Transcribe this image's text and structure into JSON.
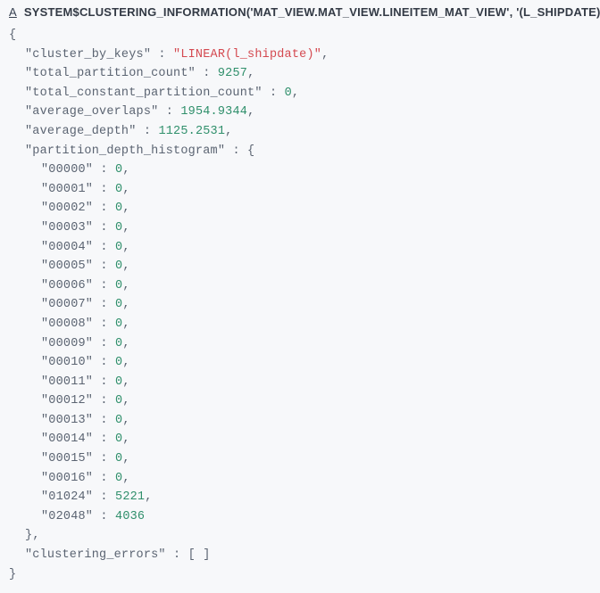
{
  "header": {
    "type_marker": "A",
    "column_title": "SYSTEM$CLUSTERING_INFORMATION('MAT_VIEW.MAT_VIEW.LINEITEM_MAT_VIEW', '(L_SHIPDATE)')"
  },
  "json": {
    "open_brace": "{",
    "close_brace": "}",
    "pairs": [
      {
        "key": "\"cluster_by_keys\"",
        "sep": " : ",
        "val": "\"LINEAR(l_shipdate)\"",
        "val_class": "str",
        "trail": ","
      },
      {
        "key": "\"total_partition_count\"",
        "sep": " : ",
        "val": "9257",
        "val_class": "num",
        "trail": ","
      },
      {
        "key": "\"total_constant_partition_count\"",
        "sep": " : ",
        "val": "0",
        "val_class": "num",
        "trail": ","
      },
      {
        "key": "\"average_overlaps\"",
        "sep": " : ",
        "val": "1954.9344",
        "val_class": "num",
        "trail": ","
      },
      {
        "key": "\"average_depth\"",
        "sep": " : ",
        "val": "1125.2531",
        "val_class": "num",
        "trail": ","
      }
    ],
    "histogram_intro": {
      "key": "\"partition_depth_histogram\"",
      "sep": " : ",
      "open": "{"
    },
    "histogram": [
      {
        "key": "\"00000\"",
        "val": "0",
        "trail": ","
      },
      {
        "key": "\"00001\"",
        "val": "0",
        "trail": ","
      },
      {
        "key": "\"00002\"",
        "val": "0",
        "trail": ","
      },
      {
        "key": "\"00003\"",
        "val": "0",
        "trail": ","
      },
      {
        "key": "\"00004\"",
        "val": "0",
        "trail": ","
      },
      {
        "key": "\"00005\"",
        "val": "0",
        "trail": ","
      },
      {
        "key": "\"00006\"",
        "val": "0",
        "trail": ","
      },
      {
        "key": "\"00007\"",
        "val": "0",
        "trail": ","
      },
      {
        "key": "\"00008\"",
        "val": "0",
        "trail": ","
      },
      {
        "key": "\"00009\"",
        "val": "0",
        "trail": ","
      },
      {
        "key": "\"00010\"",
        "val": "0",
        "trail": ","
      },
      {
        "key": "\"00011\"",
        "val": "0",
        "trail": ","
      },
      {
        "key": "\"00012\"",
        "val": "0",
        "trail": ","
      },
      {
        "key": "\"00013\"",
        "val": "0",
        "trail": ","
      },
      {
        "key": "\"00014\"",
        "val": "0",
        "trail": ","
      },
      {
        "key": "\"00015\"",
        "val": "0",
        "trail": ","
      },
      {
        "key": "\"00016\"",
        "val": "0",
        "trail": ","
      },
      {
        "key": "\"01024\"",
        "val": "5221",
        "trail": ","
      },
      {
        "key": "\"02048\"",
        "val": "4036",
        "trail": ""
      }
    ],
    "histogram_close": {
      "close": "}",
      "trail": ","
    },
    "clustering_errors": {
      "key": "\"clustering_errors\"",
      "sep": " : ",
      "val": "[ ]"
    }
  }
}
